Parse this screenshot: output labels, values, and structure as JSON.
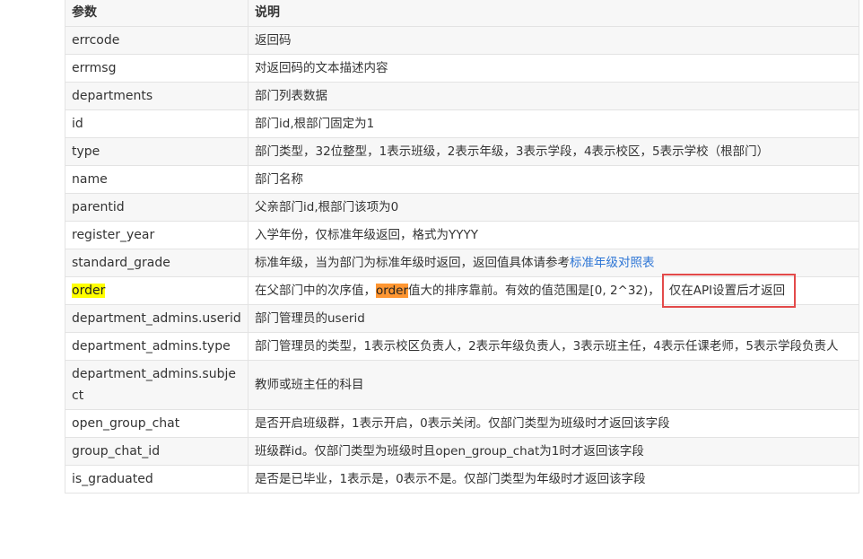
{
  "table": {
    "headers": [
      "参数",
      "说明"
    ],
    "rows": [
      {
        "name": "errcode",
        "desc": "返回码"
      },
      {
        "name": "errmsg",
        "desc": "对返回码的文本描述内容"
      },
      {
        "name": "departments",
        "desc": "部门列表数据"
      },
      {
        "name": "id",
        "desc": "部门id,根部门固定为1"
      },
      {
        "name": "type",
        "desc": "部门类型，32位整型，1表示班级，2表示年级，3表示学段，4表示校区，5表示学校（根部门）"
      },
      {
        "name": "name",
        "desc": "部门名称"
      },
      {
        "name": "parentid",
        "desc": "父亲部门id,根部门该项为0"
      },
      {
        "name": "register_year",
        "desc": "入学年份，仅标准年级返回，格式为YYYY"
      },
      {
        "name": "standard_grade",
        "desc_pre": "标准年级，当为部门为标准年级时返回，返回值具体请参考",
        "desc_link": "标准年级对照表"
      },
      {
        "name": "order",
        "desc_pre": "在父部门中的次序值，",
        "desc_hl": "order",
        "desc_mid": "值大的排序靠前。有效的值范围是[0, 2^32)，",
        "desc_boxed": "仅在API设置后才返回"
      },
      {
        "name": "department_admins.userid",
        "desc": "部门管理员的userid"
      },
      {
        "name": "department_admins.type",
        "desc": "部门管理员的类型，1表示校区负责人，2表示年级负责人，3表示班主任，4表示任课老师，5表示学段负责人"
      },
      {
        "name": "department_admins.subject",
        "desc": "教师或班主任的科目"
      },
      {
        "name": "open_group_chat",
        "desc": "是否开启班级群，1表示开启，0表示关闭。仅部门类型为班级时才返回该字段"
      },
      {
        "name": "group_chat_id",
        "desc": "班级群id。仅部门类型为班级时且open_group_chat为1时才返回该字段"
      },
      {
        "name": "is_graduated",
        "desc": "是否是已毕业，1表示是，0表示不是。仅部门类型为年级时才返回该字段"
      }
    ]
  },
  "colors": {
    "border": "#e3e3e3",
    "row_alt": "#f7f7f7",
    "link": "#2d75d5",
    "highlight_yellow": "#ffff00",
    "highlight_orange": "#ff9632",
    "annotation_box": "#e34a4a"
  }
}
